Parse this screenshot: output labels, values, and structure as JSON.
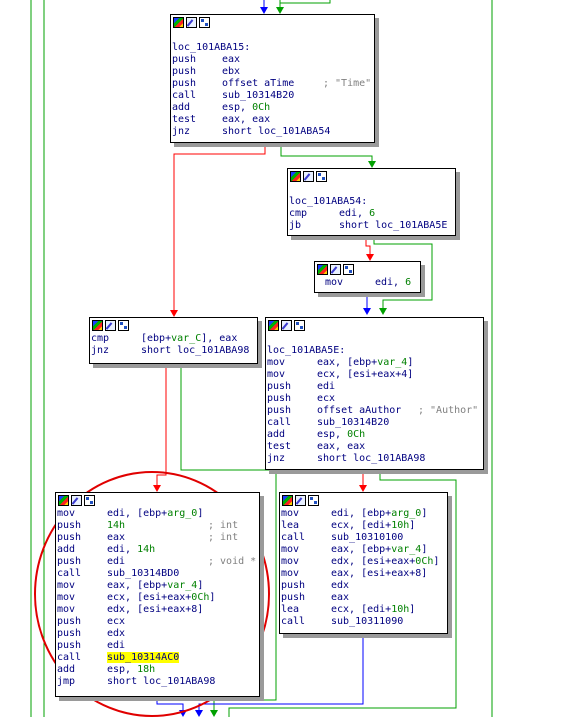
{
  "toolbar_icons": [
    "color-icon",
    "rename-icon",
    "graph-icon"
  ],
  "colors": {
    "edge_true": "#00a000",
    "edge_false": "#ff0000",
    "edge_unconditional": "#0000ff",
    "highlight": "#ffff00"
  },
  "blocks": {
    "b15": {
      "label": "loc_101ABA15:",
      "lines": [
        {
          "mn": "push",
          "op": "eax"
        },
        {
          "mn": "push",
          "op": "ebx"
        },
        {
          "mn": "push",
          "op": "offset aTime",
          "cmt": "; \"Time\""
        },
        {
          "mn": "call",
          "op": "sub_10314B20"
        },
        {
          "mn": "add",
          "op": "esp, ",
          "num": "0Ch"
        },
        {
          "mn": "test",
          "op": "eax, eax"
        },
        {
          "mn": "jnz",
          "op": "short loc_101ABA54"
        }
      ]
    },
    "b54": {
      "label": "loc_101ABA54:",
      "lines": [
        {
          "mn": "cmp",
          "op": "edi, ",
          "num": "6"
        },
        {
          "mn": "jb",
          "op": "short loc_101ABA5E"
        }
      ]
    },
    "bmov": {
      "lines": [
        {
          "mn": "mov",
          "op": "edi, ",
          "num": "6"
        }
      ]
    },
    "bcmp": {
      "lines": [
        {
          "mn": "cmp",
          "op": "[ebp+",
          "var": "var_C",
          "op2": "], eax"
        },
        {
          "mn": "jnz",
          "op": "short loc_101ABA98"
        }
      ]
    },
    "b5e": {
      "label": "loc_101ABA5E:",
      "lines": [
        {
          "mn": "mov",
          "op": "eax, [ebp+",
          "var": "var_4",
          "op2": "]"
        },
        {
          "mn": "mov",
          "op": "ecx, [esi+eax+4]"
        },
        {
          "mn": "push",
          "op": "edi"
        },
        {
          "mn": "push",
          "op": "ecx"
        },
        {
          "mn": "push",
          "op": "offset aAuthor",
          "cmt": "; \"Author\""
        },
        {
          "mn": "call",
          "op": "sub_10314B20"
        },
        {
          "mn": "add",
          "op": "esp, ",
          "num": "0Ch"
        },
        {
          "mn": "test",
          "op": "eax, eax"
        },
        {
          "mn": "jnz",
          "op": "short loc_101ABA98"
        }
      ]
    },
    "bleft": {
      "lines": [
        {
          "mn": "mov",
          "op": "edi, [ebp+",
          "var": "arg_0",
          "op2": "]"
        },
        {
          "mn": "push",
          "num": "14h",
          "cmt": "; int"
        },
        {
          "mn": "push",
          "op": "eax",
          "cmt": "; int"
        },
        {
          "mn": "add",
          "op": "edi, ",
          "num": "14h"
        },
        {
          "mn": "push",
          "op": "edi",
          "cmt": "; void *"
        },
        {
          "mn": "call",
          "op": "sub_10314BD0"
        },
        {
          "mn": "mov",
          "op": "eax, [ebp+",
          "var": "var_4",
          "op2": "]"
        },
        {
          "mn": "mov",
          "op": "ecx, [esi+eax+",
          "num": "0Ch",
          "op2": "]"
        },
        {
          "mn": "mov",
          "op": "edx, [esi+eax+8]"
        },
        {
          "mn": "push",
          "op": "ecx"
        },
        {
          "mn": "push",
          "op": "edx"
        },
        {
          "mn": "push",
          "op": "edi"
        },
        {
          "mn": "call",
          "op": "sub_10314AC0",
          "highlight": true
        },
        {
          "mn": "add",
          "op": "esp, ",
          "num": "18h"
        },
        {
          "mn": "jmp",
          "op": "short loc_101ABA98"
        }
      ]
    },
    "bright": {
      "lines": [
        {
          "mn": "mov",
          "op": "edi, [ebp+",
          "var": "arg_0",
          "op2": "]"
        },
        {
          "mn": "lea",
          "op": "ecx, [edi+",
          "num": "10h",
          "op2": "]"
        },
        {
          "mn": "call",
          "op": "sub_10310100"
        },
        {
          "mn": "mov",
          "op": "eax, [ebp+",
          "var": "var_4",
          "op2": "]"
        },
        {
          "mn": "mov",
          "op": "edx, [esi+eax+",
          "num": "0Ch",
          "op2": "]"
        },
        {
          "mn": "mov",
          "op": "eax, [esi+eax+8]"
        },
        {
          "mn": "push",
          "op": "edx"
        },
        {
          "mn": "push",
          "op": "eax"
        },
        {
          "mn": "lea",
          "op": "ecx, [edi+",
          "num": "10h",
          "op2": "]"
        },
        {
          "mn": "call",
          "op": "sub_10311090"
        }
      ]
    }
  }
}
